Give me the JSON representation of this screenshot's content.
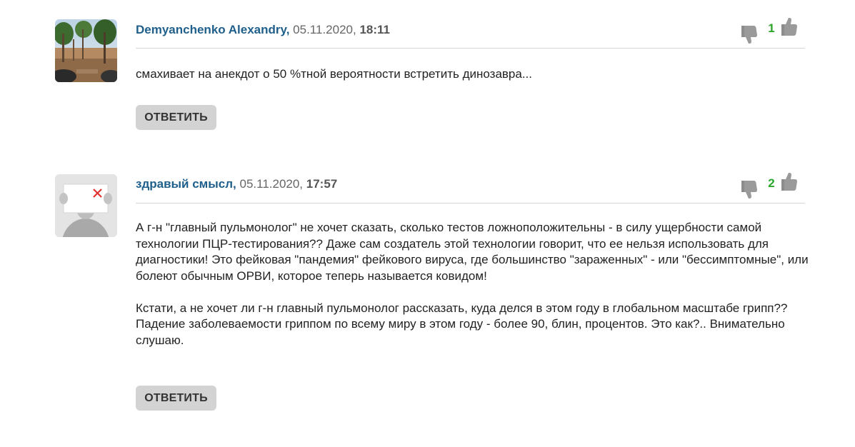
{
  "comments": [
    {
      "author": "Demyanchenko Alexandry",
      "separator": ",",
      "date": " 05.11.2020, ",
      "time": "18:11",
      "votes": "1",
      "paragraphs": [
        "смахивает на анекдот о 50 %тной вероятности встретить динозавра..."
      ],
      "reply_label": "ОТВЕТИТЬ"
    },
    {
      "author": "здравый смысл",
      "separator": ",",
      "date": " 05.11.2020, ",
      "time": "17:57",
      "votes": "2",
      "paragraphs": [
        "А г-н \"главный пульмонолог\" не хочет сказать, сколько тестов ложноположительны - в силу ущербности самой технологии ПЦР-тестирования?? Даже сам создатель этой технологии говорит, что ее нельзя использовать для диагностики! Это фейковая \"пандемия\" фейкового вируса, где большинство \"зараженных\" - или \"бессимптомные\", или болеют обычным ОРВИ, которое теперь называется ковидом!",
        "Кстати, а не хочет ли г-н главный пульмонолог рассказать, куда делся в этом году в глобальном масштабе грипп?? Падение заболеваемости гриппом по всему миру в этом году - более 90, блин, процентов. Это как?.. Внимательно слушаю."
      ],
      "reply_label": "ОТВЕТИТЬ"
    }
  ],
  "colors": {
    "author": "#1f5f8b",
    "vote_count": "#2aa62a",
    "thumb": "#9a9a9a",
    "reply_button": "#d3d3d3"
  },
  "icons": {
    "thumb_down": "thumb-down-icon",
    "thumb_up": "thumb-up-icon"
  }
}
